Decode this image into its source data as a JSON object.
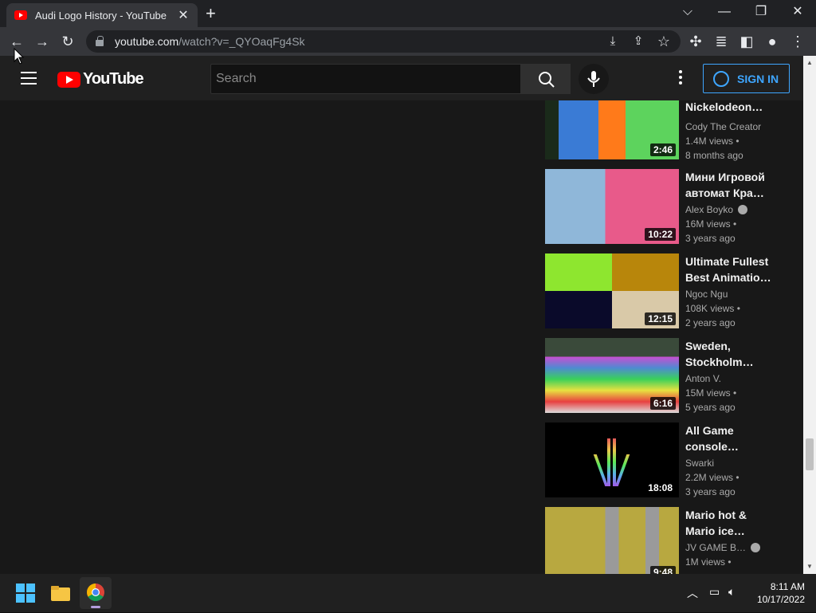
{
  "browser": {
    "tab_title": "Audi Logo History - YouTube",
    "url_host": "youtube.com",
    "url_path": "/watch?v=_QYOaqFg4Sk"
  },
  "youtube": {
    "logo_text": "YouTube",
    "search_placeholder": "Search",
    "signin_label": "SIGN IN"
  },
  "videos": [
    {
      "title_1": "",
      "title_2": "Nickelodeon…",
      "channel": "Cody The Creator",
      "views": "1.4M views •",
      "age": "8 months ago",
      "duration": "2:46",
      "verified": false
    },
    {
      "title_1": "Мини Игровой",
      "title_2": "автомат Кра…",
      "channel": "Alex Boyko",
      "views": "16M views •",
      "age": "3 years ago",
      "duration": "10:22",
      "verified": true
    },
    {
      "title_1": "Ultimate Fullest",
      "title_2": "Best Animatio…",
      "channel": "Ngoc Ngu",
      "views": "108K views •",
      "age": "2 years ago",
      "duration": "12:15",
      "verified": false
    },
    {
      "title_1": "Sweden,",
      "title_2": "Stockholm…",
      "channel": "Anton V.",
      "views": "15M views •",
      "age": "5 years ago",
      "duration": "6:16",
      "verified": false
    },
    {
      "title_1": "All Game",
      "title_2": "console…",
      "channel": "Swarki",
      "views": "2.2M views •",
      "age": "3 years ago",
      "duration": "18:08",
      "verified": false
    },
    {
      "title_1": "Mario hot &",
      "title_2": "Mario ice…",
      "channel": "JV GAME B…",
      "views": "1M views •",
      "age": "",
      "duration": "9:48",
      "verified": true
    }
  ],
  "taskbar": {
    "time": "8:11 AM",
    "date": "10/17/2022"
  }
}
